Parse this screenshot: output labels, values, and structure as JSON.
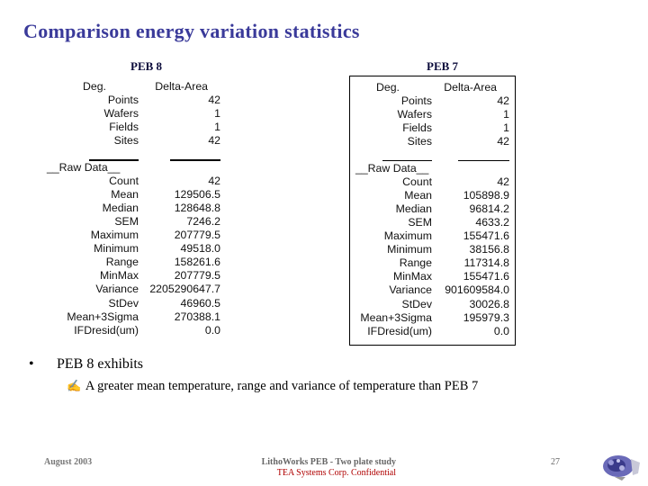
{
  "slide": {
    "title": "Comparison energy variation statistics",
    "panels": [
      {
        "label": "PEB 8",
        "header": {
          "label": "Deg.",
          "value": "Delta-Area"
        },
        "summary_rows": [
          {
            "label": "Points",
            "value": "42"
          },
          {
            "label": "Wafers",
            "value": "1"
          },
          {
            "label": "Fields",
            "value": "1"
          },
          {
            "label": "Sites",
            "value": "42"
          }
        ],
        "raw_label": "__Raw Data__",
        "raw_rows": [
          {
            "label": "Count",
            "value": "42"
          },
          {
            "label": "Mean",
            "value": "129506.5"
          },
          {
            "label": "Median",
            "value": "128648.8"
          },
          {
            "label": "SEM",
            "value": "7246.2"
          },
          {
            "label": "Maximum",
            "value": "207779.5"
          },
          {
            "label": "Minimum",
            "value": "49518.0"
          },
          {
            "label": "Range",
            "value": "158261.6"
          },
          {
            "label": "MinMax",
            "value": "207779.5"
          },
          {
            "label": "Variance",
            "value": "2205290647.7"
          },
          {
            "label": "StDev",
            "value": "46960.5"
          },
          {
            "label": "Mean+3Sigma",
            "value": "270388.1"
          },
          {
            "label": "IFDresid(um)",
            "value": "0.0"
          }
        ]
      },
      {
        "label": "PEB 7",
        "header": {
          "label": "Deg.",
          "value": "Delta-Area"
        },
        "summary_rows": [
          {
            "label": "Points",
            "value": "42"
          },
          {
            "label": "Wafers",
            "value": "1"
          },
          {
            "label": "Fields",
            "value": "1"
          },
          {
            "label": "Sites",
            "value": "42"
          }
        ],
        "raw_label": "__Raw Data__",
        "raw_rows": [
          {
            "label": "Count",
            "value": "42"
          },
          {
            "label": "Mean",
            "value": "105898.9"
          },
          {
            "label": "Median",
            "value": "96814.2"
          },
          {
            "label": "SEM",
            "value": "4633.2"
          },
          {
            "label": "Maximum",
            "value": "155471.6"
          },
          {
            "label": "Minimum",
            "value": "38156.8"
          },
          {
            "label": "Range",
            "value": "117314.8"
          },
          {
            "label": "MinMax",
            "value": "155471.6"
          },
          {
            "label": "Variance",
            "value": "901609584.0"
          },
          {
            "label": "StDev",
            "value": "30026.8"
          },
          {
            "label": "Mean+3Sigma",
            "value": "195979.3"
          },
          {
            "label": "IFDresid(um)",
            "value": "0.0"
          }
        ]
      }
    ],
    "bullet": {
      "marker": "•",
      "text": "PEB 8 exhibits",
      "sub_icon": "writing-hand-icon",
      "sub_icon_glyph": "✍",
      "sub_text": "A greater mean temperature, range and variance of temperature than PEB 7"
    },
    "footer": {
      "date": "August 2003",
      "center_line1": "LithoWorks PEB -  Two plate study",
      "center_line2": "TEA Systems Corp. Confidential",
      "page_number": "27"
    },
    "colors": {
      "title": "#3a3a9a",
      "confidential": "#b00000",
      "logo": "#5a5aa8"
    }
  }
}
